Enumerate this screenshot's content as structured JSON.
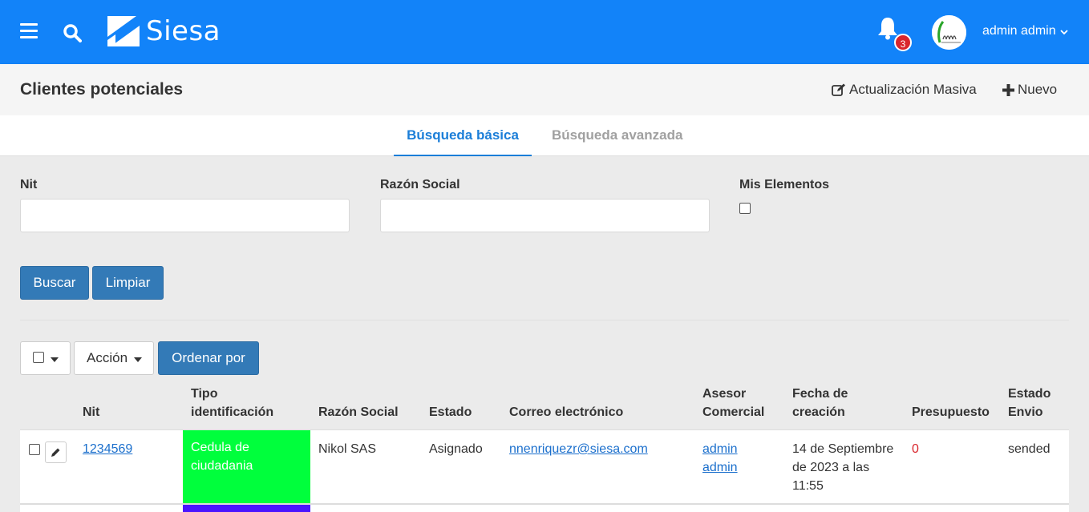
{
  "topbar": {
    "brand": "Siesa",
    "notifications_count": "3",
    "user_name": "admin admin",
    "colors": {
      "bar": "#1283f9",
      "badge": "#d9262c"
    },
    "icons": [
      "menu-icon",
      "search-icon",
      "bell-icon",
      "chevron-down-icon"
    ]
  },
  "page": {
    "title": "Clientes potenciales",
    "actions": {
      "mass_update": "Actualización Masiva",
      "new": "Nuevo"
    }
  },
  "tabs": [
    {
      "label": "Búsqueda básica",
      "active": true
    },
    {
      "label": "Búsqueda avanzada",
      "active": false
    }
  ],
  "filters": {
    "nit_label": "Nit",
    "nit_value": "",
    "razon_label": "Razón Social",
    "razon_value": "",
    "mis_elementos_label": "Mis Elementos",
    "mis_elementos_checked": false
  },
  "buttons": {
    "search": "Buscar",
    "clear": "Limpiar"
  },
  "toolbar": {
    "action": "Acción",
    "order_by": "Ordenar por"
  },
  "table": {
    "columns": [
      "Nit",
      "Tipo identificación",
      "Razón Social",
      "Estado",
      "Correo electrónico",
      "Asesor Comercial",
      "Fecha de creación",
      "Presupuesto",
      "Estado Envio"
    ],
    "rows": [
      {
        "nit": "1234569",
        "tipo": "Cedula de ciudadania",
        "tipo_color": "#00ff3c",
        "razon": "Nikol SAS",
        "estado": "Asignado",
        "correo": "nnenriquezr@siesa.com",
        "asesor": "admin admin",
        "fecha": "14 de Septiembre de 2023 a las 11:55",
        "presupuesto": "0",
        "estado_envio": "sended"
      },
      {
        "tipo_color": "#4a14ff"
      }
    ]
  }
}
